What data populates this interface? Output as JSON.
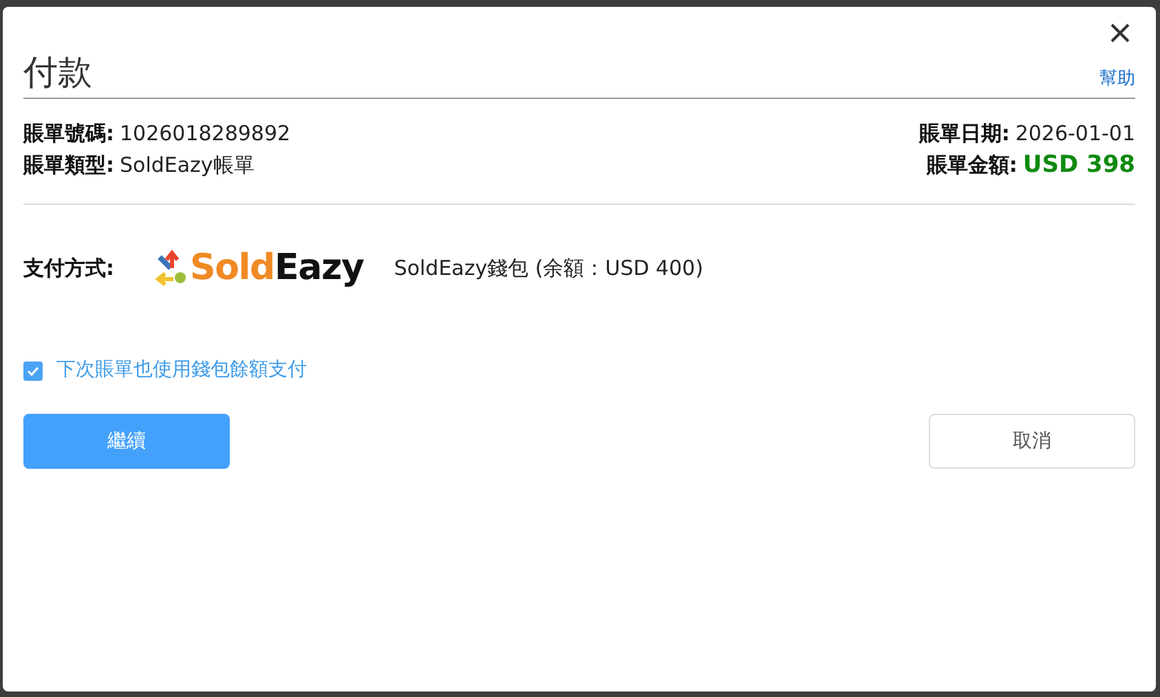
{
  "dialog": {
    "title": "付款",
    "help_link": "幫助"
  },
  "bill": {
    "left": [
      {
        "label": "賬單號碼:",
        "value": "1026018289892",
        "kind": "plain"
      },
      {
        "label": "賬單類型:",
        "value": "SoldEazy帳單",
        "kind": "plain"
      }
    ],
    "right": [
      {
        "label": "賬單日期:",
        "value": "2026-01-01",
        "kind": "plain"
      },
      {
        "label": "賬單金額:",
        "value": "USD 398",
        "kind": "amount"
      }
    ]
  },
  "payment": {
    "label": "支付方式:",
    "logo": {
      "part_1": "Sold",
      "part_2": "Eazy"
    },
    "method": "SoldEazy錢包 (余額：USD 400)"
  },
  "auto_pay": {
    "label": "下次賬單也使用錢包餘額支付",
    "checked": true
  },
  "buttons": [
    {
      "label": "繼續",
      "kind": "primary"
    },
    {
      "label": "取消",
      "kind": "secondary"
    }
  ]
}
